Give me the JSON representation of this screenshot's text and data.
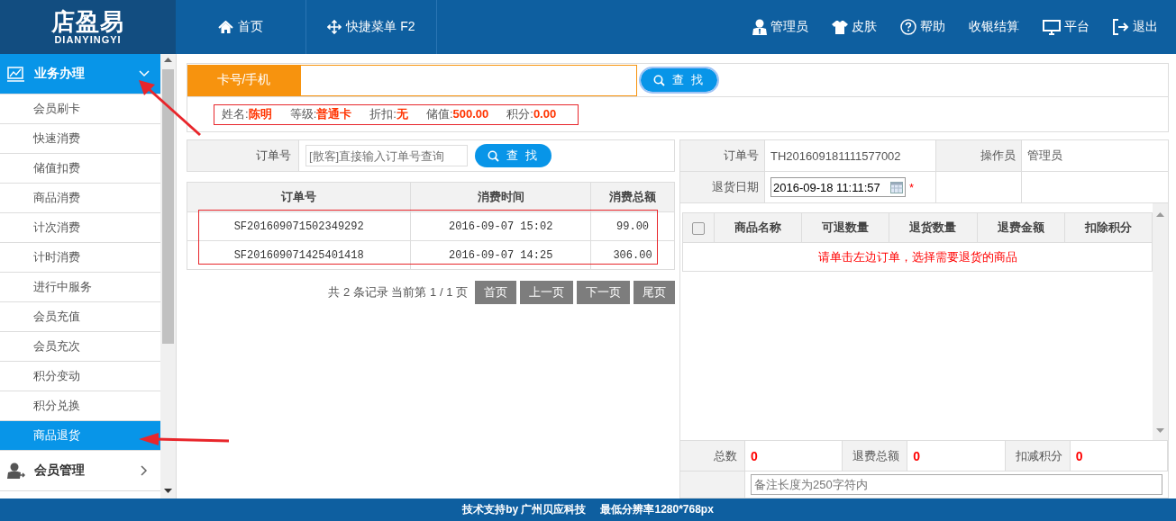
{
  "header": {
    "logo_title": "店盈易",
    "logo_subtitle": "DIANYINGYI",
    "nav": [
      {
        "label": "首页"
      },
      {
        "label": "快捷菜单 F2"
      }
    ],
    "tools": [
      {
        "label": "管理员"
      },
      {
        "label": "皮肤"
      },
      {
        "label": "帮助"
      },
      {
        "label": "收银结算"
      },
      {
        "label": "平台"
      },
      {
        "label": "退出"
      }
    ]
  },
  "sidebar": {
    "groups": [
      {
        "label": "业务办理",
        "expanded": true,
        "children": [
          {
            "label": "会员刷卡",
            "selected": false
          },
          {
            "label": "快速消费",
            "selected": false
          },
          {
            "label": "储值扣费",
            "selected": false
          },
          {
            "label": "商品消费",
            "selected": false
          },
          {
            "label": "计次消费",
            "selected": false
          },
          {
            "label": "计时消费",
            "selected": false
          },
          {
            "label": "进行中服务",
            "selected": false
          },
          {
            "label": "会员充值",
            "selected": false
          },
          {
            "label": "会员充次",
            "selected": false
          },
          {
            "label": "积分变动",
            "selected": false
          },
          {
            "label": "积分兑换",
            "selected": false
          },
          {
            "label": "商品退货",
            "selected": true
          }
        ]
      },
      {
        "label": "会员管理",
        "expanded": false
      }
    ]
  },
  "member_search": {
    "label": "卡号/手机",
    "button": "查 找",
    "info": [
      {
        "label": "姓名:",
        "value": "陈明"
      },
      {
        "label": "等级:",
        "value": "普通卡"
      },
      {
        "label": "折扣:",
        "value": "无"
      },
      {
        "label": "储值:",
        "value": "500.00"
      },
      {
        "label": "积分:",
        "value": "0.00"
      }
    ]
  },
  "order_search": {
    "label": "订单号",
    "placeholder": "[散客]直接输入订单号查询",
    "button": "查 找"
  },
  "orders": {
    "columns": [
      "订单号",
      "消费时间",
      "消费总额"
    ],
    "rows": [
      [
        "SF201609071502349292",
        "2016-09-07 15:02",
        "99.00"
      ],
      [
        "SF201609071425401418",
        "2016-09-07 14:25",
        "306.00"
      ]
    ]
  },
  "pagination": {
    "summary": "共 2 条记录 当前第 1 / 1 页",
    "buttons": [
      "首页",
      "上一页",
      "下一页",
      "尾页"
    ]
  },
  "return_form": {
    "order_label": "订单号",
    "order_no": "TH201609181111577002",
    "operator_label": "操作员",
    "operator": "管理员",
    "date_label": "退货日期",
    "date": "2016-09-18 11:11:57",
    "required_mark": "*"
  },
  "products": {
    "select_all": false,
    "columns": [
      "商品名称",
      "可退数量",
      "退货数量",
      "退费金额",
      "扣除积分"
    ],
    "empty_message": "请单击左边订单，选择需要退货的商品"
  },
  "totals": [
    {
      "label": "总数",
      "value": "0"
    },
    {
      "label": "退费总额",
      "value": "0"
    },
    {
      "label": "扣减积分",
      "value": "0"
    }
  ],
  "remark": {
    "placeholder": "备注长度为250字符内"
  },
  "footer": {
    "support": "技术支持by 广州贝应科技",
    "resolution": "最低分辨率1280*768px"
  }
}
